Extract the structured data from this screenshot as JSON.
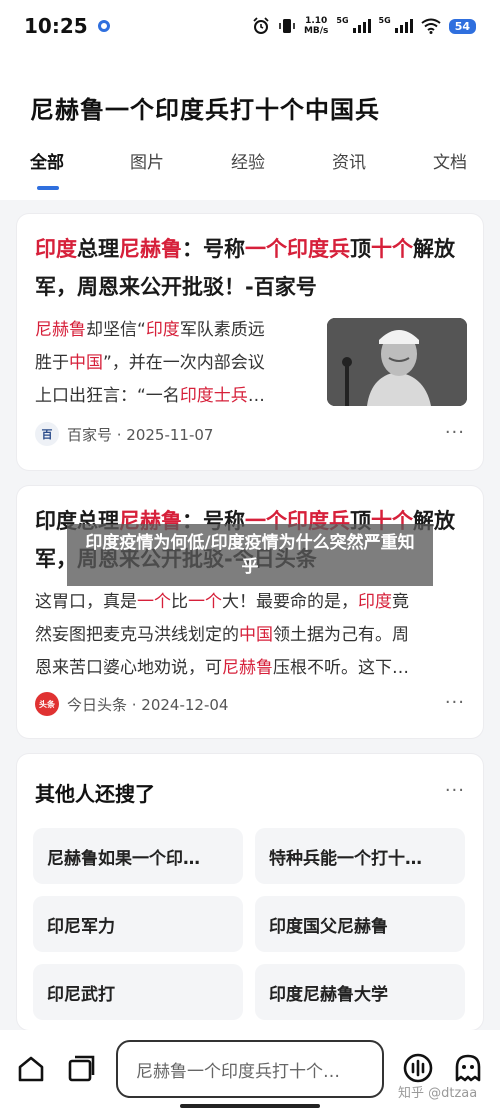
{
  "status_bar": {
    "time": "10:25",
    "net_speed_value": "1.10",
    "net_speed_unit": "MB/s",
    "sim1": "5G",
    "sim2": "5G",
    "battery": "54"
  },
  "header": {
    "title": "尼赫鲁一个印度兵打十个中国兵",
    "tabs": [
      "全部",
      "图片",
      "经验",
      "资讯",
      "文档"
    ],
    "active_tab": "全部"
  },
  "results": [
    {
      "title_parts": [
        {
          "text": "印度",
          "hl": true
        },
        {
          "text": "总理",
          "hl": false
        },
        {
          "text": "尼赫鲁",
          "hl": true
        },
        {
          "text": "：号称",
          "hl": false
        },
        {
          "text": "一个印度兵",
          "hl": true
        },
        {
          "text": "顶",
          "hl": false
        },
        {
          "text": "十个",
          "hl": true
        },
        {
          "text": "解放军，周恩来公开批驳！-百家号",
          "hl": false
        }
      ],
      "snippet_lines": [
        [
          {
            "text": "尼赫鲁",
            "hl": true
          },
          {
            "text": "却坚信“",
            "hl": false
          },
          {
            "text": "印度",
            "hl": true
          },
          {
            "text": "军队素质远",
            "hl": false
          }
        ],
        [
          {
            "text": "胜于",
            "hl": false
          },
          {
            "text": "中国",
            "hl": true
          },
          {
            "text": "”，并在一次内部会议",
            "hl": false
          }
        ],
        [
          {
            "text": "上口出狂言：“一名",
            "hl": false
          },
          {
            "text": "印度士兵",
            "hl": true
          },
          {
            "text": "…",
            "hl": false
          }
        ]
      ],
      "source_icon": "百",
      "source": "百家号 · 2025-11-07",
      "more": "···"
    },
    {
      "title_parts": [
        {
          "text": "印度",
          "hl": false
        },
        {
          "text": "总理",
          "hl": false
        },
        {
          "text": "尼赫鲁",
          "hl": true
        },
        {
          "text": "：号称",
          "hl": false
        },
        {
          "text": "一个印度兵",
          "hl": true
        },
        {
          "text": "顶",
          "hl": false
        },
        {
          "text": "十个",
          "hl": true
        },
        {
          "text": "解放军，周恩来公开批驳-今日头条",
          "hl": false
        }
      ],
      "snippet_lines": [
        [
          {
            "text": "这胃口，真是",
            "hl": false
          },
          {
            "text": "一个",
            "hl": true
          },
          {
            "text": "比",
            "hl": false
          },
          {
            "text": "一个",
            "hl": true
          },
          {
            "text": "大！最要命的是，",
            "hl": false
          },
          {
            "text": "印度",
            "hl": true
          },
          {
            "text": "竟",
            "hl": false
          }
        ],
        [
          {
            "text": "然妄图把麦克马洪线划定的",
            "hl": false
          },
          {
            "text": "中国",
            "hl": true
          },
          {
            "text": "领土据为己有。周",
            "hl": false
          }
        ],
        [
          {
            "text": "恩来苦口婆心地劝说，可",
            "hl": false
          },
          {
            "text": "尼赫鲁",
            "hl": true
          },
          {
            "text": "压根不听。这下…",
            "hl": false
          }
        ]
      ],
      "source_icon": "头条",
      "source": "今日头条 · 2024-12-04",
      "more": "···"
    }
  ],
  "overlay_text": "印度疫情为何低/印度疫情为什么突然严重知乎",
  "related": {
    "title": "其他人还搜了",
    "more": "···",
    "items": [
      "尼赫鲁如果一个印…",
      "特种兵能一个打十…",
      "印尼军力",
      "印度国父尼赫鲁",
      "印尼武打",
      "印度尼赫鲁大学"
    ]
  },
  "bottom_bar": {
    "search_placeholder": "尼赫鲁一个印度兵打十个…"
  },
  "watermark": "知乎 @dtzaa",
  "colors": {
    "accent": "#2f6fde",
    "highlight": "#d6203a"
  }
}
